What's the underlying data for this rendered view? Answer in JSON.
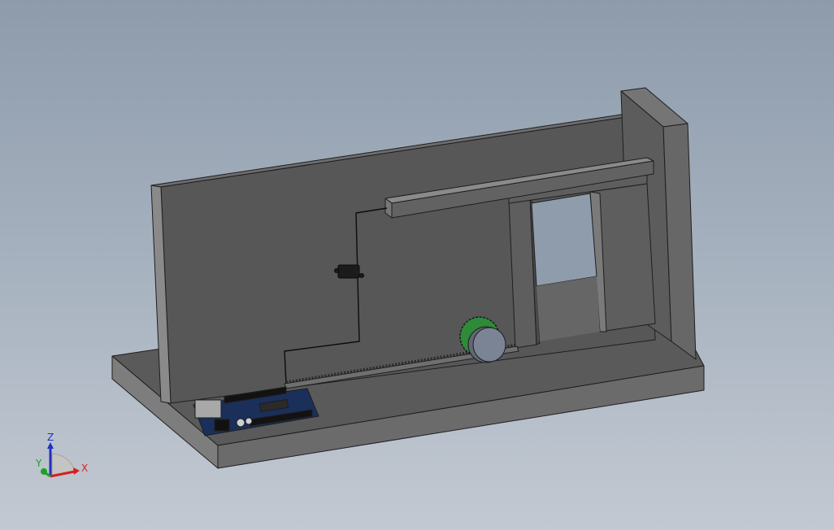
{
  "viewport": {
    "background_top": "#8d9bab",
    "background_bottom": "#c3c9d2"
  },
  "model": {
    "part_color": "#595959",
    "edge_color": "#1e1e1e",
    "gear_color": "#2f8a3a",
    "board_color": "#1a2f5a"
  },
  "triad": {
    "x_label": "X",
    "y_label": "Y",
    "z_label": "Z",
    "x_color": "#d22020",
    "y_color": "#20a020",
    "z_color": "#2030c0"
  }
}
